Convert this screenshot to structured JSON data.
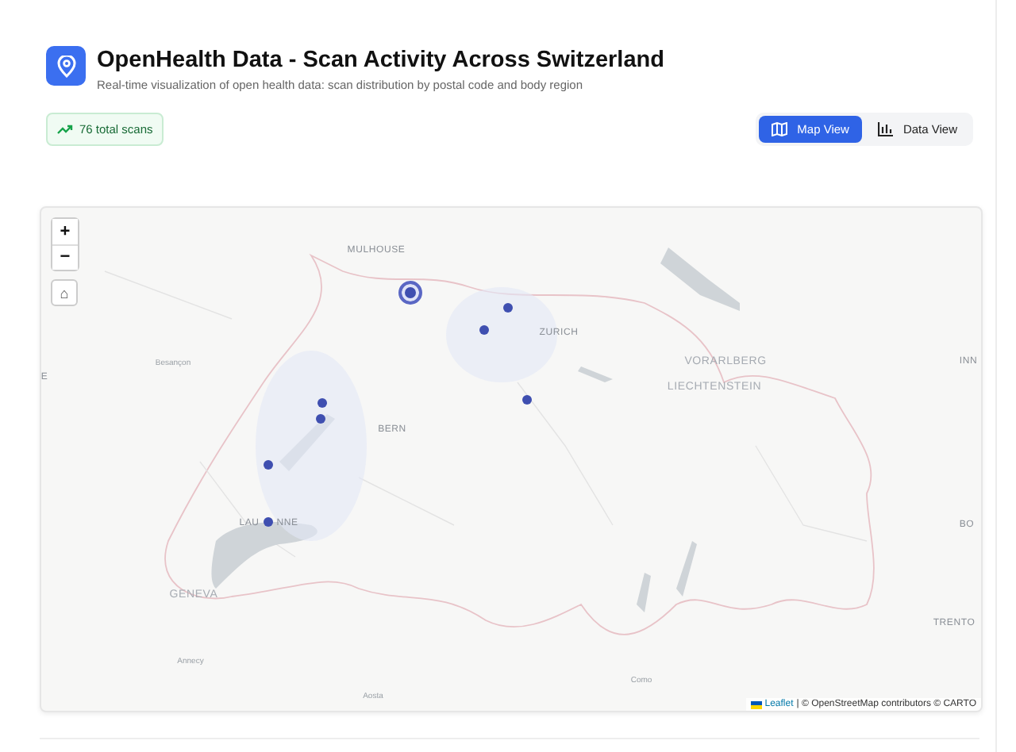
{
  "header": {
    "title": "OpenHealth Data - Scan Activity Across Switzerland",
    "subtitle": "Real-time visualization of open health data: scan distribution by postal code and body region"
  },
  "total_badge": "76 total scans",
  "view_tabs": [
    {
      "label": "Map View",
      "selected": true
    },
    {
      "label": "Data View",
      "selected": false
    }
  ],
  "map": {
    "zoom_in": "+",
    "zoom_out": "−",
    "home": "⌂",
    "place_labels": [
      {
        "text": "MULHOUSE",
        "kind": "city"
      },
      {
        "text": "ZURICH",
        "kind": "city"
      },
      {
        "text": "Besançon",
        "kind": "town"
      },
      {
        "text": "VORARLBERG",
        "kind": "region"
      },
      {
        "text": "INN",
        "kind": "city"
      },
      {
        "text": "E",
        "kind": "city"
      },
      {
        "text": "LIECHTENSTEIN",
        "kind": "region"
      },
      {
        "text": "BERN",
        "kind": "city"
      },
      {
        "text": "LAU",
        "kind": "city"
      },
      {
        "text": "NNE",
        "kind": "city"
      },
      {
        "text": "BO",
        "kind": "city"
      },
      {
        "text": "GENEVA",
        "kind": "region"
      },
      {
        "text": "TRENTO",
        "kind": "city"
      },
      {
        "text": "Annecy",
        "kind": "town"
      },
      {
        "text": "Como",
        "kind": "town"
      },
      {
        "text": "Aosta",
        "kind": "town"
      }
    ],
    "markers": [
      {
        "highlighted": true
      },
      {
        "highlighted": false
      },
      {
        "highlighted": false
      },
      {
        "highlighted": false
      },
      {
        "highlighted": false
      },
      {
        "highlighted": false
      },
      {
        "highlighted": false
      },
      {
        "highlighted": false
      }
    ],
    "attribution": {
      "link": "Leaflet",
      "text": "| © OpenStreetMap contributors © CARTO"
    }
  }
}
